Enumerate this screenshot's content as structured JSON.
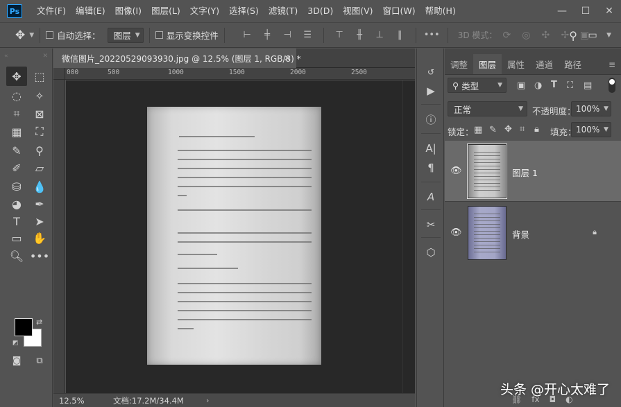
{
  "app": {
    "logo": "Ps"
  },
  "menu": [
    "文件(F)",
    "编辑(E)",
    "图像(I)",
    "图层(L)",
    "文字(Y)",
    "选择(S)",
    "滤镜(T)",
    "3D(D)",
    "视图(V)",
    "窗口(W)",
    "帮助(H)"
  ],
  "window_controls": {
    "minimize": "—",
    "maximize": "☐",
    "close": "✕"
  },
  "options": {
    "auto_select_label": "自动选择：",
    "auto_select_target": "图层",
    "show_transform_label": "显示变换控件",
    "more": "•••",
    "mode_3d": "3D 模式："
  },
  "document": {
    "tab_title": "微信图片_20220529093930.jpg @ 12.5% (图层 1, RGB/8) *",
    "ruler_ticks": [
      "000",
      "500",
      "1000",
      "1500",
      "2000",
      "2500"
    ],
    "zoom": "12.5%",
    "doc_size": "文档:17.2M/34.4M",
    "status_arrow": "›"
  },
  "panel": {
    "tabs": [
      "调整",
      "图层",
      "属性",
      "通道",
      "路径"
    ],
    "active_tab": "图层",
    "filter_label": "类型",
    "blend_mode": "正常",
    "opacity_label": "不透明度：",
    "opacity_value": "100%",
    "lock_label": "锁定：",
    "fill_label": "填充：",
    "fill_value": "100%",
    "layers": [
      {
        "name": "图层 1",
        "selected": true,
        "visible": true,
        "locked": false
      },
      {
        "name": "背景",
        "selected": false,
        "visible": true,
        "locked": true
      }
    ]
  },
  "watermark": "头条 @开心太难了",
  "colors": {
    "foreground": "#000000",
    "background": "#ffffff",
    "accent": "#31a8ff"
  },
  "icons": {
    "tools": [
      "move-icon",
      "marquee-icon",
      "lasso-icon",
      "magic-wand-icon",
      "crop-icon",
      "frame-icon",
      "ruler-icon",
      "patch-icon",
      "brush-icon",
      "stamp-icon",
      "history-brush-icon",
      "eraser-icon",
      "paint-bucket-icon",
      "blur-icon",
      "dodge-icon",
      "pen-icon",
      "type-icon",
      "path-select-icon",
      "rectangle-icon",
      "hand-icon",
      "zoom-icon",
      "more-tools-icon",
      "quick-mask-icon",
      "screen-mode-icon"
    ]
  }
}
